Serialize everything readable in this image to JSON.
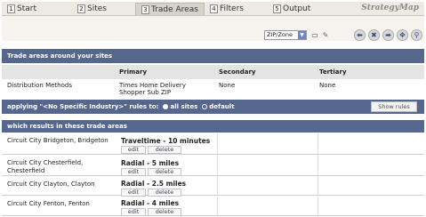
{
  "tabs": [
    {
      "num": "1",
      "label": "Start"
    },
    {
      "num": "2",
      "label": "Sites"
    },
    {
      "num": "3",
      "label": "Trade Areas"
    },
    {
      "num": "4",
      "label": "Filters"
    },
    {
      "num": "5",
      "label": "Output"
    }
  ],
  "brand": "StrategyMap",
  "toolbar": {
    "zone_select": "ZIP/Zone",
    "tool_icons": [
      "cursor-icon",
      "pencil-icon"
    ],
    "nav_icons": [
      "back-arrow-icon",
      "close-icon",
      "forward-arrow-icon",
      "pan-icon",
      "zoom-icon"
    ]
  },
  "trade_areas_band": "Trade areas around your sites",
  "headers": {
    "primary": "Primary",
    "secondary": "Secondary",
    "tertiary": "Tertiary"
  },
  "distribution": {
    "label": "Distribution Methods",
    "primary": "Times Home Delivery Shopper Sub ZIP",
    "secondary": "None",
    "tertiary": "None"
  },
  "rules_band": {
    "text": "applying \"<No Specific Industry>\" rules to:",
    "option_all": "all sites",
    "option_default": "default",
    "button": "Show rules"
  },
  "results_band": "which results in these trade areas",
  "rows": [
    {
      "name": "Circuit City Bridgeton, Bridgeton",
      "trade_area": "Traveltime - 10 minutes",
      "edit": "edit",
      "delete": "delete"
    },
    {
      "name": "Circuit City Chesterfield, Chesterfield",
      "trade_area": "Radial - 5 miles",
      "edit": "edit",
      "delete": "delete"
    },
    {
      "name": "Circuit City Clayton, Clayton",
      "trade_area": "Radial - 2.5 miles",
      "edit": "edit",
      "delete": "delete"
    },
    {
      "name": "Circuit City Fenton, Fenton",
      "trade_area": "Radial - 4 miles",
      "edit": "edit",
      "delete": "delete"
    }
  ]
}
